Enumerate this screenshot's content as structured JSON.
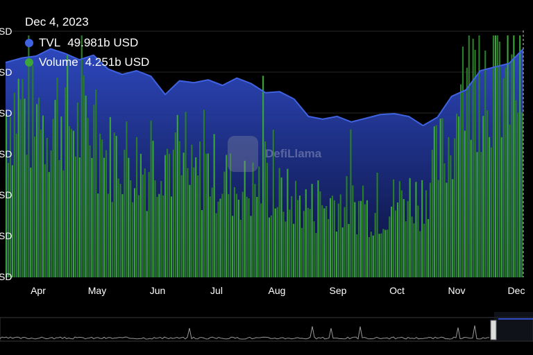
{
  "tooltip": {
    "date": "Dec 4, 2023",
    "tvl_label": "TVL",
    "tvl_value": "49.981b USD",
    "volume_label": "Volume",
    "volume_value": "4.251b USD"
  },
  "watermark": {
    "text": "DefiLlama"
  },
  "colors": {
    "tvl_line": "#3f63e0",
    "tvl_fill_top": "#2f4bc6",
    "tvl_fill_bottom": "#0b1240",
    "volume_bar": "#3ba53a",
    "volume_bar_dark": "#2b7d2b",
    "background": "#000000",
    "brush_line": "#9a9a9a"
  },
  "chart_data": {
    "type": "area",
    "x_axis": {
      "ticks": [
        "Apr",
        "May",
        "Jun",
        "Jul",
        "Aug",
        "Sep",
        "Oct",
        "Nov",
        "Dec"
      ],
      "start": "2023-03-26",
      "end": "2023-12-04"
    },
    "y_axis_tick_fragments": [
      "SD",
      "SD",
      "SD",
      "SD",
      "SD",
      "SD",
      "SD"
    ],
    "grid": true,
    "series": [
      {
        "name": "TVL",
        "unit": "billion USD",
        "points": [
          [
            "2023-03-26",
            48.5
          ],
          [
            "2023-04-03",
            49.0
          ],
          [
            "2023-04-10",
            49.2
          ],
          [
            "2023-04-17",
            50.0
          ],
          [
            "2023-04-24",
            49.5
          ],
          [
            "2023-05-01",
            48.8
          ],
          [
            "2023-05-08",
            49.3
          ],
          [
            "2023-05-15",
            47.8
          ],
          [
            "2023-05-22",
            47.2
          ],
          [
            "2023-05-29",
            47.6
          ],
          [
            "2023-06-05",
            47.0
          ],
          [
            "2023-06-12",
            45.0
          ],
          [
            "2023-06-19",
            46.5
          ],
          [
            "2023-06-26",
            46.3
          ],
          [
            "2023-07-03",
            46.6
          ],
          [
            "2023-07-10",
            46.0
          ],
          [
            "2023-07-17",
            46.8
          ],
          [
            "2023-07-24",
            46.2
          ],
          [
            "2023-07-31",
            45.2
          ],
          [
            "2023-08-07",
            45.3
          ],
          [
            "2023-08-14",
            44.5
          ],
          [
            "2023-08-21",
            42.6
          ],
          [
            "2023-08-28",
            42.3
          ],
          [
            "2023-09-04",
            42.6
          ],
          [
            "2023-09-11",
            42.0
          ],
          [
            "2023-09-18",
            42.4
          ],
          [
            "2023-09-25",
            42.8
          ],
          [
            "2023-10-02",
            42.9
          ],
          [
            "2023-10-09",
            42.6
          ],
          [
            "2023-10-16",
            41.6
          ],
          [
            "2023-10-23",
            42.5
          ],
          [
            "2023-10-30",
            44.8
          ],
          [
            "2023-11-06",
            45.5
          ],
          [
            "2023-11-13",
            47.6
          ],
          [
            "2023-11-20",
            48.0
          ],
          [
            "2023-11-27",
            48.4
          ],
          [
            "2023-12-04",
            49.981
          ]
        ]
      },
      {
        "name": "Volume",
        "unit": "billion USD",
        "type": "bar",
        "weekly_levels": [
          3.6,
          3.9,
          3.3,
          3.5,
          3.7,
          3.2,
          3.4,
          2.6,
          2.8,
          2.5,
          2.4,
          2.9,
          2.3,
          2.1,
          2.4,
          2.2,
          2.0,
          1.9,
          2.1,
          1.8,
          1.7,
          1.6,
          1.5,
          1.7,
          1.6,
          1.5,
          1.4,
          1.6,
          1.8,
          1.7,
          2.4,
          2.9,
          4.0,
          4.5,
          4.6,
          4.3,
          4.251
        ]
      }
    ]
  }
}
